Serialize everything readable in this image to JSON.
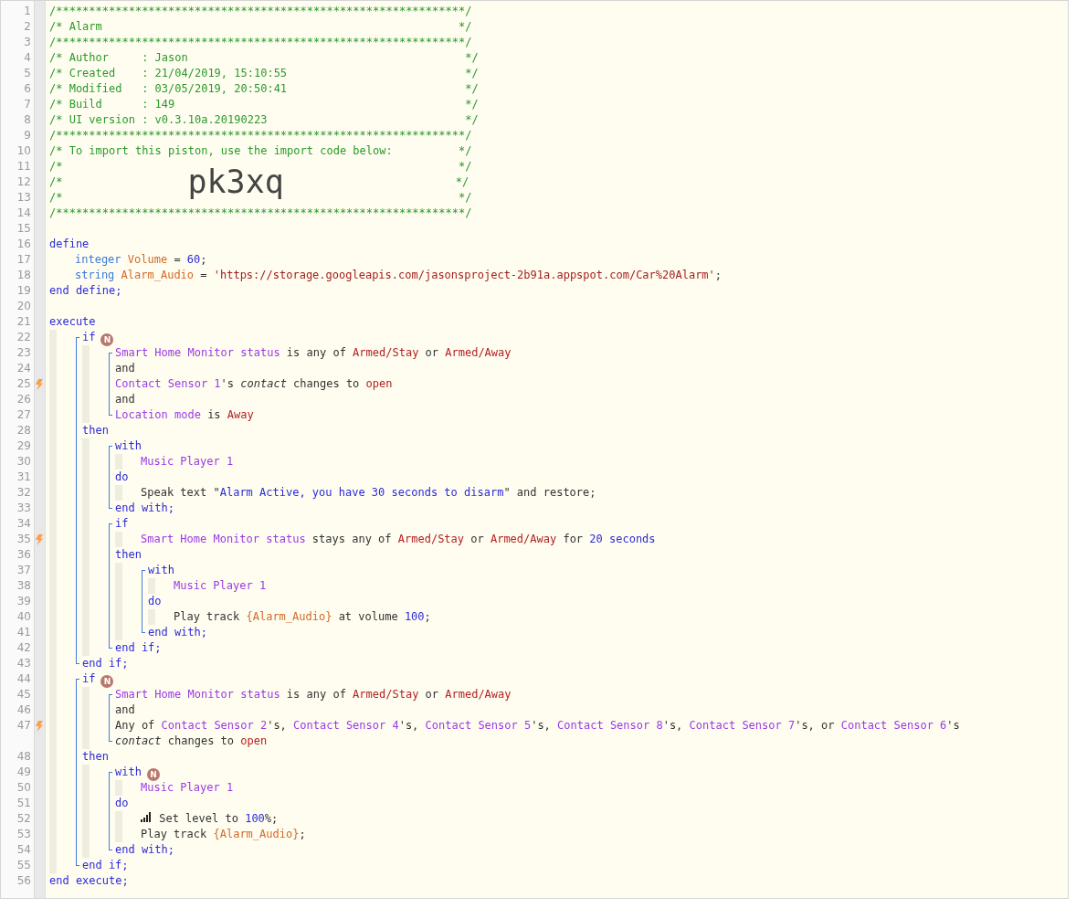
{
  "editor": {
    "code": [
      {
        "kind": "line",
        "number": "1",
        "trigger": false,
        "tokens": [
          {
            "kind": "comment",
            "text": "/**************************************************************/"
          }
        ]
      },
      {
        "kind": "line",
        "number": "2",
        "trigger": false,
        "tokens": [
          {
            "kind": "comment",
            "text": "/* Alarm                                                      */"
          }
        ]
      },
      {
        "kind": "line",
        "number": "3",
        "trigger": false,
        "tokens": [
          {
            "kind": "comment",
            "text": "/**************************************************************/"
          }
        ]
      },
      {
        "kind": "line",
        "number": "4",
        "trigger": false,
        "tokens": [
          {
            "kind": "comment",
            "text": "/* Author     : Jason                                          */"
          }
        ]
      },
      {
        "kind": "line",
        "number": "5",
        "trigger": false,
        "tokens": [
          {
            "kind": "comment",
            "text": "/* Created    : 21/04/2019, 15:10:55                           */"
          }
        ]
      },
      {
        "kind": "line",
        "number": "6",
        "trigger": false,
        "tokens": [
          {
            "kind": "comment",
            "text": "/* Modified   : 03/05/2019, 20:50:41                           */"
          }
        ]
      },
      {
        "kind": "line",
        "number": "7",
        "trigger": false,
        "tokens": [
          {
            "kind": "comment",
            "text": "/* Build      : 149                                            */"
          }
        ]
      },
      {
        "kind": "line",
        "number": "8",
        "trigger": false,
        "tokens": [
          {
            "kind": "comment",
            "text": "/* UI version : v0.3.10a.20190223                              */"
          }
        ]
      },
      {
        "kind": "line",
        "number": "9",
        "trigger": false,
        "tokens": [
          {
            "kind": "comment",
            "text": "/**************************************************************/"
          }
        ]
      },
      {
        "kind": "line",
        "number": "10",
        "trigger": false,
        "tokens": [
          {
            "kind": "comment",
            "text": "/* To import this piston, use the import code below:          */"
          }
        ]
      },
      {
        "kind": "line",
        "number": "11",
        "trigger": false,
        "tokens": [
          {
            "kind": "comment",
            "text": "/*                                                            */"
          }
        ]
      },
      {
        "kind": "line",
        "number": "12",
        "trigger": false,
        "tokens": [
          {
            "kind": "comment",
            "text": "/*"
          },
          {
            "kind": "import-code",
            "text": "pk3xq"
          },
          {
            "kind": "comment",
            "text": "*/"
          }
        ]
      },
      {
        "kind": "line",
        "number": "13",
        "trigger": false,
        "tokens": [
          {
            "kind": "comment",
            "text": "/*                                                            */"
          }
        ]
      },
      {
        "kind": "line",
        "number": "14",
        "trigger": false,
        "tokens": [
          {
            "kind": "comment",
            "text": "/**************************************************************/"
          }
        ]
      },
      {
        "kind": "line",
        "number": "15",
        "trigger": false
      },
      {
        "kind": "line",
        "number": "16",
        "trigger": false,
        "tokens": [
          {
            "kind": "keyword",
            "text": "define"
          }
        ]
      },
      {
        "kind": "nest",
        "children": [
          {
            "kind": "line",
            "number": "17",
            "trigger": false,
            "tokens": [
              {
                "kind": "type",
                "text": "integer "
              },
              {
                "kind": "variable",
                "text": "Volume"
              },
              {
                "kind": "plain",
                "text": " = "
              },
              {
                "kind": "number",
                "text": "60"
              },
              {
                "kind": "plain",
                "text": ";"
              }
            ]
          },
          {
            "kind": "line",
            "number": "18",
            "trigger": false,
            "tokens": [
              {
                "kind": "type",
                "text": "string "
              },
              {
                "kind": "variable",
                "text": "Alarm_Audio"
              },
              {
                "kind": "plain",
                "text": " = "
              },
              {
                "kind": "string",
                "text": "'https://storage.googleapis.com/jasonsproject-2b91a.appspot.com/Car%20Alarm'"
              },
              {
                "kind": "plain",
                "text": ";"
              }
            ]
          }
        ]
      },
      {
        "kind": "line",
        "number": "19",
        "trigger": false,
        "tokens": [
          {
            "kind": "keyword",
            "text": "end define;"
          }
        ]
      },
      {
        "kind": "line",
        "number": "20",
        "trigger": false
      },
      {
        "kind": "line",
        "number": "21",
        "trigger": false,
        "tokens": [
          {
            "kind": "keyword",
            "text": "execute"
          }
        ]
      },
      {
        "kind": "indent",
        "children": [
          {
            "kind": "bracket",
            "children": [
              {
                "kind": "line",
                "number": "22",
                "trigger": false,
                "tokens": [
                  {
                    "kind": "keyword",
                    "text": "if"
                  },
                  {
                    "kind": "badge",
                    "text": "N"
                  }
                ]
              },
              {
                "kind": "indent",
                "children": [
                  {
                    "kind": "bracket",
                    "children": [
                      {
                        "kind": "line",
                        "number": "23",
                        "trigger": false,
                        "tokens": [
                          {
                            "kind": "device",
                            "text": "Smart Home Monitor status"
                          },
                          {
                            "kind": "plain",
                            "text": " is any of "
                          },
                          {
                            "kind": "value",
                            "text": "Armed/Stay"
                          },
                          {
                            "kind": "plain",
                            "text": " or "
                          },
                          {
                            "kind": "value",
                            "text": "Armed/Away"
                          }
                        ]
                      },
                      {
                        "kind": "line",
                        "number": "24",
                        "trigger": false,
                        "tokens": [
                          {
                            "kind": "plain",
                            "text": "and"
                          }
                        ]
                      },
                      {
                        "kind": "line",
                        "number": "25",
                        "trigger": true,
                        "tokens": [
                          {
                            "kind": "device",
                            "text": "Contact Sensor 1"
                          },
                          {
                            "kind": "plain",
                            "text": "'s "
                          },
                          {
                            "kind": "italic",
                            "text": "contact"
                          },
                          {
                            "kind": "plain",
                            "text": " changes to "
                          },
                          {
                            "kind": "value",
                            "text": "open"
                          }
                        ]
                      },
                      {
                        "kind": "line",
                        "number": "26",
                        "trigger": false,
                        "tokens": [
                          {
                            "kind": "plain",
                            "text": "and"
                          }
                        ]
                      },
                      {
                        "kind": "line",
                        "number": "27",
                        "trigger": false,
                        "tokens": [
                          {
                            "kind": "device",
                            "text": "Location mode"
                          },
                          {
                            "kind": "plain",
                            "text": " is "
                          },
                          {
                            "kind": "value",
                            "text": "Away"
                          }
                        ]
                      }
                    ]
                  }
                ]
              },
              {
                "kind": "line",
                "number": "28",
                "trigger": false,
                "tokens": [
                  {
                    "kind": "keyword",
                    "text": "then"
                  }
                ]
              },
              {
                "kind": "indent",
                "children": [
                  {
                    "kind": "bracket",
                    "children": [
                      {
                        "kind": "line",
                        "number": "29",
                        "trigger": false,
                        "tokens": [
                          {
                            "kind": "keyword",
                            "text": "with"
                          }
                        ]
                      },
                      {
                        "kind": "indent",
                        "children": [
                          {
                            "kind": "line",
                            "number": "30",
                            "trigger": false,
                            "tokens": [
                              {
                                "kind": "device",
                                "text": "Music Player 1"
                              }
                            ]
                          }
                        ]
                      },
                      {
                        "kind": "line",
                        "number": "31",
                        "trigger": false,
                        "tokens": [
                          {
                            "kind": "keyword",
                            "text": "do"
                          }
                        ]
                      },
                      {
                        "kind": "indent",
                        "children": [
                          {
                            "kind": "line",
                            "number": "32",
                            "trigger": false,
                            "tokens": [
                              {
                                "kind": "plain",
                                "text": "Speak text \""
                              },
                              {
                                "kind": "number",
                                "text": "Alarm Active, you have 30 seconds to disarm"
                              },
                              {
                                "kind": "plain",
                                "text": "\" and restore;"
                              }
                            ]
                          }
                        ]
                      },
                      {
                        "kind": "line",
                        "number": "33",
                        "trigger": false,
                        "tokens": [
                          {
                            "kind": "keyword",
                            "text": "end with;"
                          }
                        ]
                      }
                    ]
                  },
                  {
                    "kind": "bracket",
                    "children": [
                      {
                        "kind": "line",
                        "number": "34",
                        "trigger": false,
                        "tokens": [
                          {
                            "kind": "keyword",
                            "text": "if"
                          }
                        ]
                      },
                      {
                        "kind": "indent",
                        "children": [
                          {
                            "kind": "line",
                            "number": "35",
                            "trigger": true,
                            "tokens": [
                              {
                                "kind": "device",
                                "text": "Smart Home Monitor status"
                              },
                              {
                                "kind": "plain",
                                "text": " stays any of "
                              },
                              {
                                "kind": "value",
                                "text": "Armed/Stay"
                              },
                              {
                                "kind": "plain",
                                "text": " or "
                              },
                              {
                                "kind": "value",
                                "text": "Armed/Away"
                              },
                              {
                                "kind": "plain",
                                "text": " for "
                              },
                              {
                                "kind": "number",
                                "text": "20 seconds"
                              }
                            ]
                          }
                        ]
                      },
                      {
                        "kind": "line",
                        "number": "36",
                        "trigger": false,
                        "tokens": [
                          {
                            "kind": "keyword",
                            "text": "then"
                          }
                        ]
                      },
                      {
                        "kind": "indent",
                        "children": [
                          {
                            "kind": "bracket",
                            "children": [
                              {
                                "kind": "line",
                                "number": "37",
                                "trigger": false,
                                "tokens": [
                                  {
                                    "kind": "keyword",
                                    "text": "with"
                                  }
                                ]
                              },
                              {
                                "kind": "indent",
                                "children": [
                                  {
                                    "kind": "line",
                                    "number": "38",
                                    "trigger": false,
                                    "tokens": [
                                      {
                                        "kind": "device",
                                        "text": "Music Player 1"
                                      }
                                    ]
                                  }
                                ]
                              },
                              {
                                "kind": "line",
                                "number": "39",
                                "trigger": false,
                                "tokens": [
                                  {
                                    "kind": "keyword",
                                    "text": "do"
                                  }
                                ]
                              },
                              {
                                "kind": "indent",
                                "children": [
                                  {
                                    "kind": "line",
                                    "number": "40",
                                    "trigger": false,
                                    "tokens": [
                                      {
                                        "kind": "plain",
                                        "text": "Play track "
                                      },
                                      {
                                        "kind": "variable",
                                        "text": "{Alarm_Audio}"
                                      },
                                      {
                                        "kind": "plain",
                                        "text": " at volume "
                                      },
                                      {
                                        "kind": "number",
                                        "text": "100"
                                      },
                                      {
                                        "kind": "plain",
                                        "text": ";"
                                      }
                                    ]
                                  }
                                ]
                              },
                              {
                                "kind": "line",
                                "number": "41",
                                "trigger": false,
                                "tokens": [
                                  {
                                    "kind": "keyword",
                                    "text": "end with;"
                                  }
                                ]
                              }
                            ]
                          }
                        ]
                      },
                      {
                        "kind": "line",
                        "number": "42",
                        "trigger": false,
                        "tokens": [
                          {
                            "kind": "keyword",
                            "text": "end if;"
                          }
                        ]
                      }
                    ]
                  }
                ]
              },
              {
                "kind": "line",
                "number": "43",
                "trigger": false,
                "tokens": [
                  {
                    "kind": "keyword",
                    "text": "end if;"
                  }
                ]
              }
            ]
          },
          {
            "kind": "bracket",
            "children": [
              {
                "kind": "line",
                "number": "44",
                "trigger": false,
                "tokens": [
                  {
                    "kind": "keyword",
                    "text": "if"
                  },
                  {
                    "kind": "badge",
                    "text": "N"
                  }
                ]
              },
              {
                "kind": "indent",
                "children": [
                  {
                    "kind": "bracket",
                    "children": [
                      {
                        "kind": "line",
                        "number": "45",
                        "trigger": false,
                        "tokens": [
                          {
                            "kind": "device",
                            "text": "Smart Home Monitor status"
                          },
                          {
                            "kind": "plain",
                            "text": " is any of "
                          },
                          {
                            "kind": "value",
                            "text": "Armed/Stay"
                          },
                          {
                            "kind": "plain",
                            "text": " or "
                          },
                          {
                            "kind": "value",
                            "text": "Armed/Away"
                          }
                        ]
                      },
                      {
                        "kind": "line",
                        "number": "46",
                        "trigger": false,
                        "tokens": [
                          {
                            "kind": "plain",
                            "text": "and"
                          }
                        ]
                      },
                      {
                        "kind": "line",
                        "number": "47",
                        "trigger": true,
                        "tokens": [
                          {
                            "kind": "plain",
                            "text": "Any of "
                          },
                          {
                            "kind": "device",
                            "text": "Contact Sensor 2"
                          },
                          {
                            "kind": "plain",
                            "text": "'s, "
                          },
                          {
                            "kind": "device",
                            "text": "Contact Sensor 4"
                          },
                          {
                            "kind": "plain",
                            "text": "'s, "
                          },
                          {
                            "kind": "device",
                            "text": "Contact Sensor 5"
                          },
                          {
                            "kind": "plain",
                            "text": "'s, "
                          },
                          {
                            "kind": "device",
                            "text": "Contact Sensor 8"
                          },
                          {
                            "kind": "plain",
                            "text": "'s, "
                          },
                          {
                            "kind": "device",
                            "text": "Contact Sensor 7"
                          },
                          {
                            "kind": "plain",
                            "text": "'s, or "
                          },
                          {
                            "kind": "device",
                            "text": "Contact Sensor 6"
                          },
                          {
                            "kind": "plain",
                            "text": "'s"
                          },
                          {
                            "kind": "break"
                          },
                          {
                            "kind": "italic",
                            "text": "contact"
                          },
                          {
                            "kind": "plain",
                            "text": " changes to "
                          },
                          {
                            "kind": "value",
                            "text": "open"
                          }
                        ]
                      }
                    ]
                  }
                ]
              },
              {
                "kind": "line",
                "number": "48",
                "trigger": false,
                "tokens": [
                  {
                    "kind": "keyword",
                    "text": "then"
                  }
                ]
              },
              {
                "kind": "indent",
                "children": [
                  {
                    "kind": "bracket",
                    "children": [
                      {
                        "kind": "line",
                        "number": "49",
                        "trigger": false,
                        "tokens": [
                          {
                            "kind": "keyword",
                            "text": "with"
                          },
                          {
                            "kind": "badge",
                            "text": "N"
                          }
                        ]
                      },
                      {
                        "kind": "indent",
                        "children": [
                          {
                            "kind": "line",
                            "number": "50",
                            "trigger": false,
                            "tokens": [
                              {
                                "kind": "device",
                                "text": "Music Player 1"
                              }
                            ]
                          }
                        ]
                      },
                      {
                        "kind": "line",
                        "number": "51",
                        "trigger": false,
                        "tokens": [
                          {
                            "kind": "keyword",
                            "text": "do"
                          }
                        ]
                      },
                      {
                        "kind": "indent",
                        "children": [
                          {
                            "kind": "line",
                            "number": "52",
                            "trigger": false,
                            "tokens": [
                              {
                                "kind": "level-icon"
                              },
                              {
                                "kind": "plain",
                                "text": " Set level to "
                              },
                              {
                                "kind": "number",
                                "text": "100"
                              },
                              {
                                "kind": "plain",
                                "text": "%;"
                              }
                            ]
                          },
                          {
                            "kind": "line",
                            "number": "53",
                            "trigger": false,
                            "tokens": [
                              {
                                "kind": "plain",
                                "text": "Play track "
                              },
                              {
                                "kind": "variable",
                                "text": "{Alarm_Audio}"
                              },
                              {
                                "kind": "plain",
                                "text": ";"
                              }
                            ]
                          }
                        ]
                      },
                      {
                        "kind": "line",
                        "number": "54",
                        "trigger": false,
                        "tokens": [
                          {
                            "kind": "keyword",
                            "text": "end with;"
                          }
                        ]
                      }
                    ]
                  }
                ]
              },
              {
                "kind": "line",
                "number": "55",
                "trigger": false,
                "tokens": [
                  {
                    "kind": "keyword",
                    "text": "end if;"
                  }
                ]
              }
            ]
          }
        ]
      },
      {
        "kind": "line",
        "number": "56",
        "trigger": false,
        "tokens": [
          {
            "kind": "keyword",
            "text": "end execute;"
          }
        ]
      }
    ]
  }
}
